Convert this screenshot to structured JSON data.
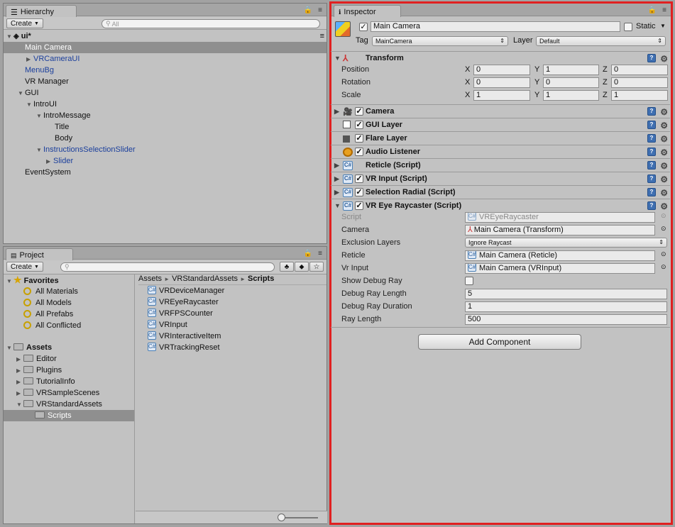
{
  "hierarchy": {
    "tab": "Hierarchy",
    "create": "Create",
    "search_placeholder": "All",
    "scene": "ui*",
    "items": {
      "main_camera": "Main Camera",
      "vrcamera_ui": "VRCameraUI",
      "menu_bg": "MenuBg",
      "vr_manager": "VR Manager",
      "gui": "GUI",
      "intro_ui": "IntroUI",
      "intro_message": "IntroMessage",
      "title": "Title",
      "body": "Body",
      "instructions_slider": "InstructionsSelectionSlider",
      "slider": "Slider",
      "event_system": "EventSystem"
    }
  },
  "project": {
    "tab": "Project",
    "create": "Create",
    "favorites": {
      "label": "Favorites",
      "items": [
        "All Materials",
        "All Models",
        "All Prefabs",
        "All Conflicted"
      ]
    },
    "assets": {
      "label": "Assets",
      "folders": [
        "Editor",
        "Plugins",
        "TutorialInfo",
        "VRSampleScenes",
        "VRStandardAssets"
      ],
      "scripts_folder": "Scripts"
    },
    "breadcrumb": {
      "a": "Assets",
      "sep": "►",
      "b": "VRStandardAssets",
      "c": "Scripts"
    },
    "files": [
      "VRDeviceManager",
      "VREyeRaycaster",
      "VRFPSCounter",
      "VRInput",
      "VRInteractiveItem",
      "VRTrackingReset"
    ]
  },
  "inspector": {
    "tab": "Inspector",
    "object_name": "Main Camera",
    "static_label": "Static",
    "tag_label": "Tag",
    "tag_value": "MainCamera",
    "layer_label": "Layer",
    "layer_value": "Default",
    "transform": {
      "title": "Transform",
      "position_label": "Position",
      "rotation_label": "Rotation",
      "scale_label": "Scale",
      "axis_x": "X",
      "axis_y": "Y",
      "axis_z": "Z",
      "position": {
        "x": "0",
        "y": "1",
        "z": "0"
      },
      "rotation": {
        "x": "0",
        "y": "0",
        "z": "0"
      },
      "scale": {
        "x": "1",
        "y": "1",
        "z": "1"
      }
    },
    "components": {
      "camera": "Camera",
      "gui_layer": "GUI Layer",
      "flare_layer": "Flare Layer",
      "audio_listener": "Audio Listener",
      "reticle": "Reticle (Script)",
      "vr_input": "VR Input (Script)",
      "selection_radial": "Selection Radial (Script)",
      "vr_eye_raycaster": "VR Eye Raycaster (Script)"
    },
    "raycaster": {
      "script_label": "Script",
      "script_value": "VREyeRaycaster",
      "camera_label": "Camera",
      "camera_value": "Main Camera (Transform)",
      "exclusion_label": "Exclusion Layers",
      "exclusion_value": "Ignore Raycast",
      "reticle_label": "Reticle",
      "reticle_value": "Main Camera (Reticle)",
      "vrinput_label": "Vr Input",
      "vrinput_value": "Main Camera (VRInput)",
      "show_debug_label": "Show Debug Ray",
      "debug_length_label": "Debug Ray Length",
      "debug_length_value": "5",
      "debug_duration_label": "Debug Ray Duration",
      "debug_duration_value": "1",
      "ray_length_label": "Ray Length",
      "ray_length_value": "500"
    },
    "add_component": "Add Component"
  },
  "colors": {
    "highlight": "#e02020",
    "selection": "#8f8f8f",
    "link": "#1b3f9c"
  }
}
